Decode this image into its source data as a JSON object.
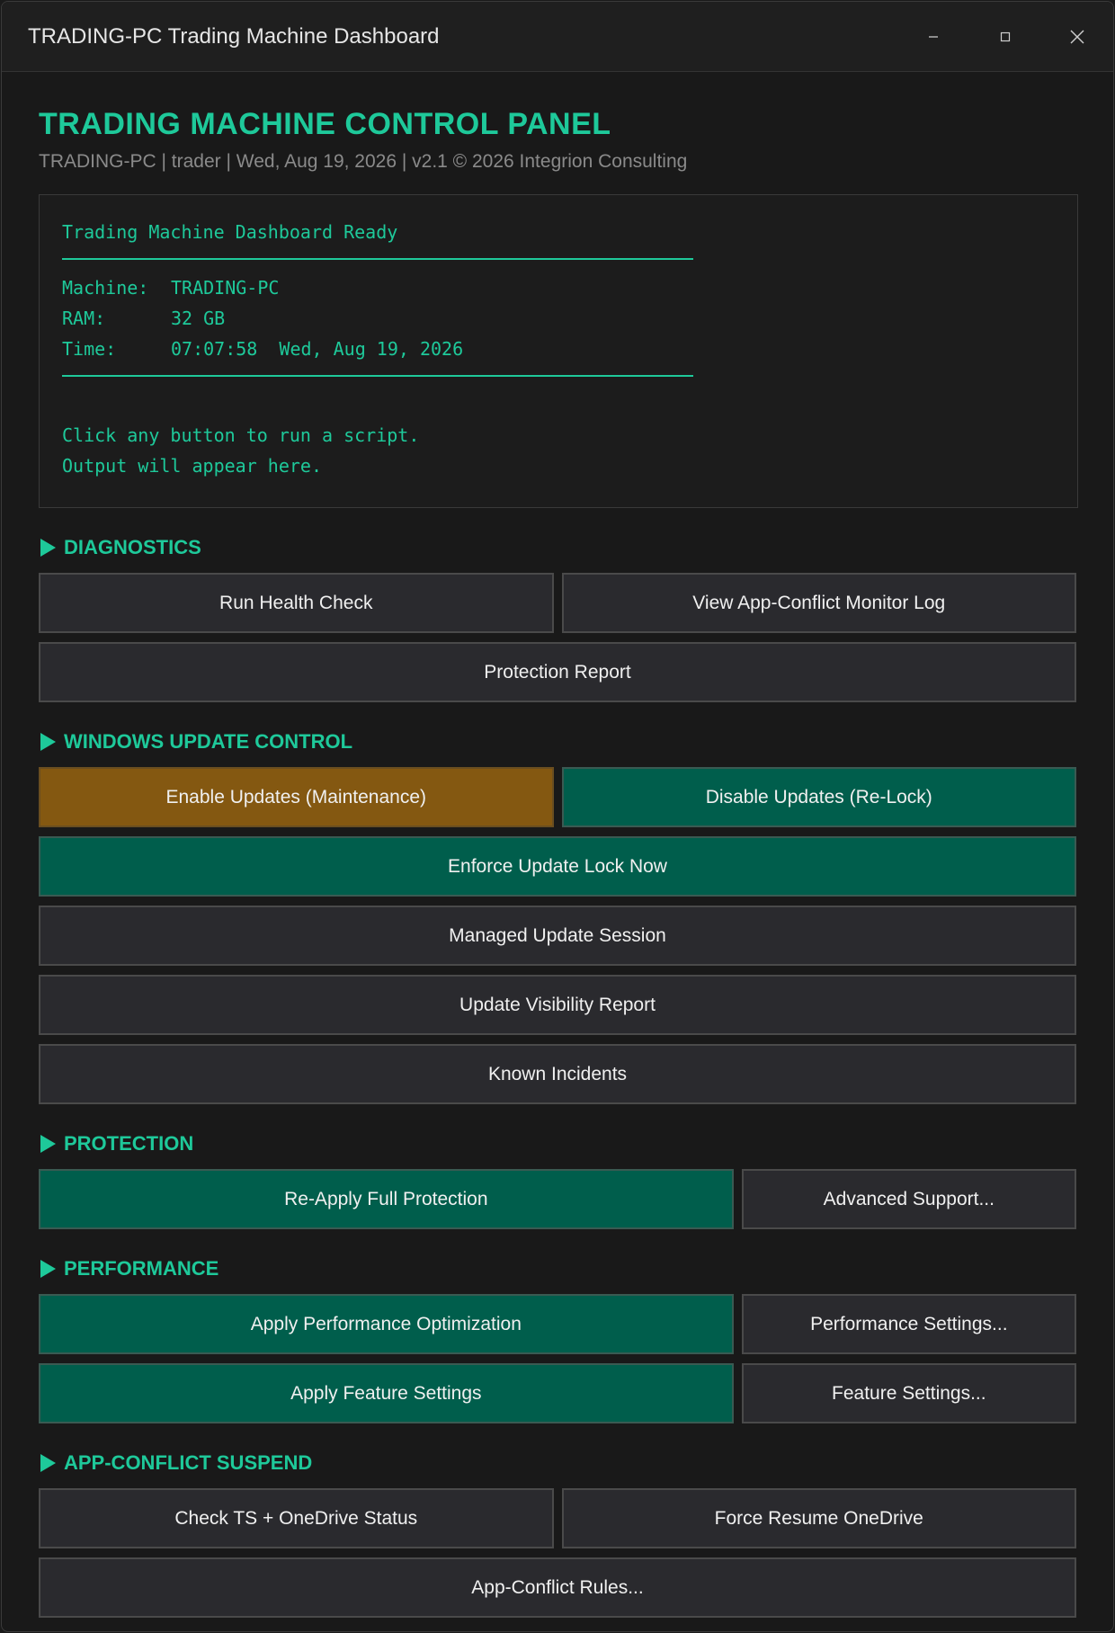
{
  "window": {
    "title": "TRADING-PC Trading Machine Dashboard",
    "controls": {
      "minimize": "–",
      "maximize": "□",
      "close": "✕"
    }
  },
  "header": {
    "title": "TRADING MACHINE CONTROL PANEL",
    "subtitle": "TRADING-PC | trader | Wed, Aug 19, 2026 | v2.1 © 2026 Integrion Consulting"
  },
  "console": {
    "heading": "Trading Machine Dashboard Ready",
    "machine_label": "Machine:",
    "machine_value": "TRADING-PC",
    "ram_label": "RAM:",
    "ram_value": "32 GB",
    "time_label": "Time:",
    "time_value": "07:07:58  Wed, Aug 19, 2026",
    "hint1": "Click any button to run a script.",
    "hint2": "Output will appear here."
  },
  "sections": {
    "diagnostics": {
      "title": "DIAGNOSTICS",
      "run_health_check": "Run Health Check",
      "view_conflict_log": "View App-Conflict Monitor Log",
      "protection_report": "Protection Report"
    },
    "updates": {
      "title": "WINDOWS UPDATE CONTROL",
      "enable_updates": "Enable Updates (Maintenance)",
      "disable_updates": "Disable Updates (Re-Lock)",
      "enforce_lock": "Enforce Update Lock Now",
      "managed_session": "Managed Update Session",
      "visibility_report": "Update Visibility Report",
      "known_incidents": "Known Incidents"
    },
    "protection": {
      "title": "PROTECTION",
      "reapply_full": "Re-Apply Full Protection",
      "advanced_support": "Advanced Support..."
    },
    "performance": {
      "title": "PERFORMANCE",
      "apply_optimization": "Apply Performance Optimization",
      "performance_settings": "Performance Settings...",
      "apply_feature": "Apply Feature Settings",
      "feature_settings": "Feature Settings..."
    },
    "conflict": {
      "title": "APP-CONFLICT SUSPEND",
      "check_status": "Check TS + OneDrive Status",
      "force_resume": "Force Resume OneDrive",
      "rules": "App-Conflict Rules..."
    }
  },
  "colors": {
    "accent": "#1ec99a",
    "teal_button": "#005e4c",
    "amber_button": "#845811",
    "neutral_button": "#2a2a2e",
    "background": "#191919"
  }
}
